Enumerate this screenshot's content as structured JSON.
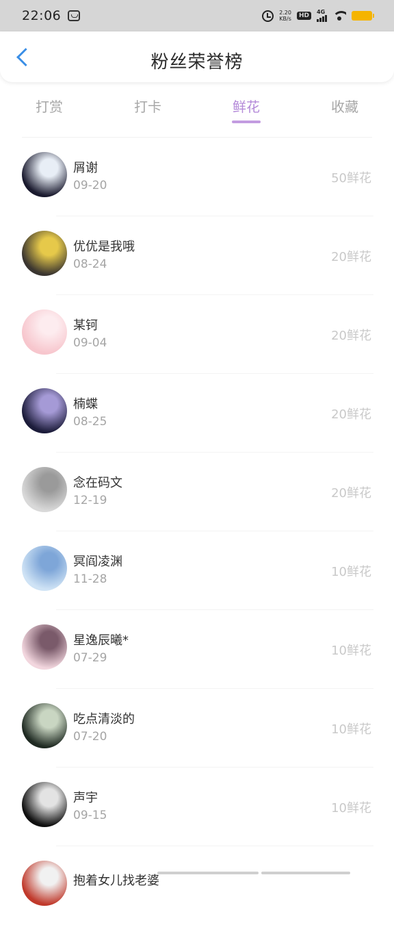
{
  "status_bar": {
    "time": "22:06",
    "speed_value": "2.20",
    "speed_unit": "KB/s",
    "hd_label": "HD",
    "network_label": "4G"
  },
  "header": {
    "title": "粉丝荣誉榜"
  },
  "tabs": [
    {
      "label": "打赏",
      "active": false
    },
    {
      "label": "打卡",
      "active": false
    },
    {
      "label": "鲜花",
      "active": true
    },
    {
      "label": "收藏",
      "active": false
    }
  ],
  "list": [
    {
      "name": "屑谢",
      "date": "09-20",
      "amount": "50鲜花",
      "avatar_colors": [
        "#1a1a2e",
        "#e8eef6"
      ]
    },
    {
      "name": "优优是我哦",
      "date": "08-24",
      "amount": "20鲜花",
      "avatar_colors": [
        "#3a3530",
        "#e6c94a"
      ]
    },
    {
      "name": "某钶",
      "date": "09-04",
      "amount": "20鲜花",
      "avatar_colors": [
        "#f7c6cd",
        "#fdecef"
      ]
    },
    {
      "name": "楠蝶",
      "date": "08-25",
      "amount": "20鲜花",
      "avatar_colors": [
        "#1c1c3a",
        "#a59ad6"
      ]
    },
    {
      "name": "念在码文",
      "date": "12-19",
      "amount": "20鲜花",
      "avatar_colors": [
        "#d9d9d9",
        "#9a9a9a"
      ]
    },
    {
      "name": "冥阎凌渊",
      "date": "11-28",
      "amount": "10鲜花",
      "avatar_colors": [
        "#cfe3f5",
        "#7ea6d8"
      ]
    },
    {
      "name": "星逸辰曦*",
      "date": "07-29",
      "amount": "10鲜花",
      "avatar_colors": [
        "#f2d6de",
        "#7a5a6a"
      ]
    },
    {
      "name": "吃点清淡的",
      "date": "07-20",
      "amount": "10鲜花",
      "avatar_colors": [
        "#1f2a22",
        "#c9d6c2"
      ]
    },
    {
      "name": "声宇",
      "date": "09-15",
      "amount": "10鲜花",
      "avatar_colors": [
        "#101010",
        "#e3e3e3"
      ]
    },
    {
      "name": "抱着女儿找老婆",
      "date": "",
      "amount": "",
      "avatar_colors": [
        "#c0392b",
        "#f1f1f1"
      ]
    }
  ],
  "colors": {
    "accent": "#b48ad9",
    "back_arrow": "#3a8ee6",
    "muted_text": "#a5a5a5"
  }
}
